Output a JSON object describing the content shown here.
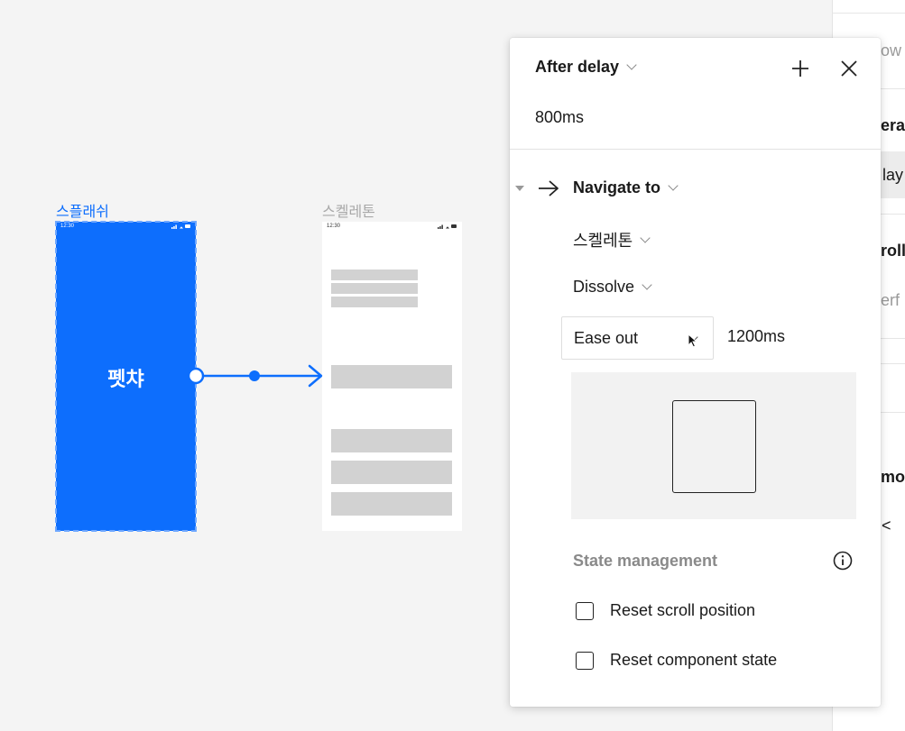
{
  "canvas": {
    "frames": [
      {
        "name": "스플래쉬",
        "status_time": "12:30",
        "logo": "펫챠",
        "selected": true
      },
      {
        "name": "스켈레톤",
        "status_time": "12:30"
      }
    ]
  },
  "right_panel": {
    "fragments": [
      "ow s",
      "era",
      "lay",
      "roll",
      "erf",
      "mo",
      "<"
    ]
  },
  "interaction": {
    "trigger": "After delay",
    "delay": "800ms",
    "action": "Navigate to",
    "destination": "스켈레톤",
    "animation": "Dissolve",
    "easing": "Ease out",
    "duration": "1200ms",
    "state_management": {
      "title": "State management",
      "options": [
        {
          "label": "Reset scroll position",
          "checked": false
        },
        {
          "label": "Reset component state",
          "checked": false
        }
      ]
    }
  },
  "icons": {
    "add": "plus-icon",
    "close": "close-icon",
    "action": "arrow-right-icon",
    "info": "info-icon",
    "cursor": "mouse-cursor-icon"
  },
  "colors": {
    "selection": "#0d6efd",
    "skeleton": "#d2d2d2",
    "muted_text": "#8a8a8a"
  }
}
